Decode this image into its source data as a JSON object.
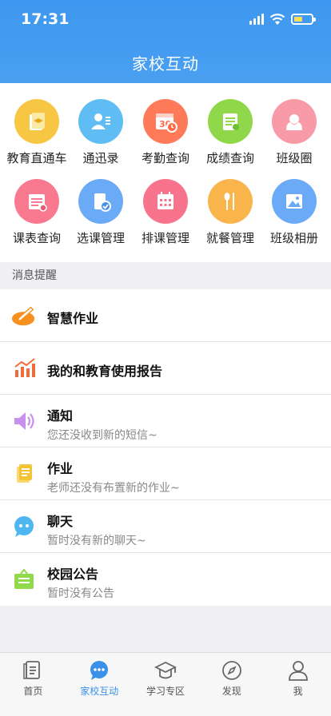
{
  "status_bar": {
    "time": "17:31"
  },
  "header": {
    "title": "家校互动"
  },
  "grid": [
    {
      "label": "教育直通车",
      "icon": "education-express-icon",
      "color": "#f7c744"
    },
    {
      "label": "通迅录",
      "icon": "contacts-icon",
      "color": "#5fbdf3"
    },
    {
      "label": "考勤查询",
      "icon": "attendance-calendar-icon",
      "color": "#ff7a59"
    },
    {
      "label": "成绩查询",
      "icon": "grades-icon",
      "color": "#8ed84a"
    },
    {
      "label": "班级圈",
      "icon": "class-circle-icon",
      "color": "#f99aa8"
    },
    {
      "label": "课表查询",
      "icon": "timetable-icon",
      "color": "#f97a8e"
    },
    {
      "label": "选课管理",
      "icon": "course-select-icon",
      "color": "#6aaaf6"
    },
    {
      "label": "排课管理",
      "icon": "schedule-icon",
      "color": "#f7748c"
    },
    {
      "label": "就餐管理",
      "icon": "dining-icon",
      "color": "#f9b44b"
    },
    {
      "label": "班级相册",
      "icon": "album-icon",
      "color": "#6aaaf6"
    }
  ],
  "section": {
    "title": "消息提醒"
  },
  "messages": [
    {
      "title": "智慧作业",
      "subtitle": "",
      "icon": "smart-homework-icon",
      "color": "#f6901e"
    },
    {
      "title": "我的和教育使用报告",
      "subtitle": "",
      "icon": "usage-report-icon",
      "color": "#f26b3a"
    },
    {
      "title": "通知",
      "subtitle": "您还没收到新的短信~",
      "icon": "speaker-icon",
      "color": "#c792ee"
    },
    {
      "title": "作业",
      "subtitle": "老师还没有布置新的作业~",
      "icon": "homework-icon",
      "color": "#f5c436"
    },
    {
      "title": "聊天",
      "subtitle": "暂时没有新的聊天~",
      "icon": "chat-icon",
      "color": "#4fb7ef"
    },
    {
      "title": "校园公告",
      "subtitle": "暂时没有公告",
      "icon": "announcement-icon",
      "color": "#8fd94b"
    }
  ],
  "tabs": [
    {
      "label": "首页",
      "icon": "home-icon",
      "active": false
    },
    {
      "label": "家校互动",
      "icon": "chat-bubble-icon",
      "active": true
    },
    {
      "label": "学习专区",
      "icon": "graduation-cap-icon",
      "active": false
    },
    {
      "label": "发现",
      "icon": "compass-icon",
      "active": false
    },
    {
      "label": "我",
      "icon": "person-icon",
      "active": false
    }
  ],
  "colors": {
    "primary": "#3e98ef",
    "active_tab": "#3a91ea"
  }
}
